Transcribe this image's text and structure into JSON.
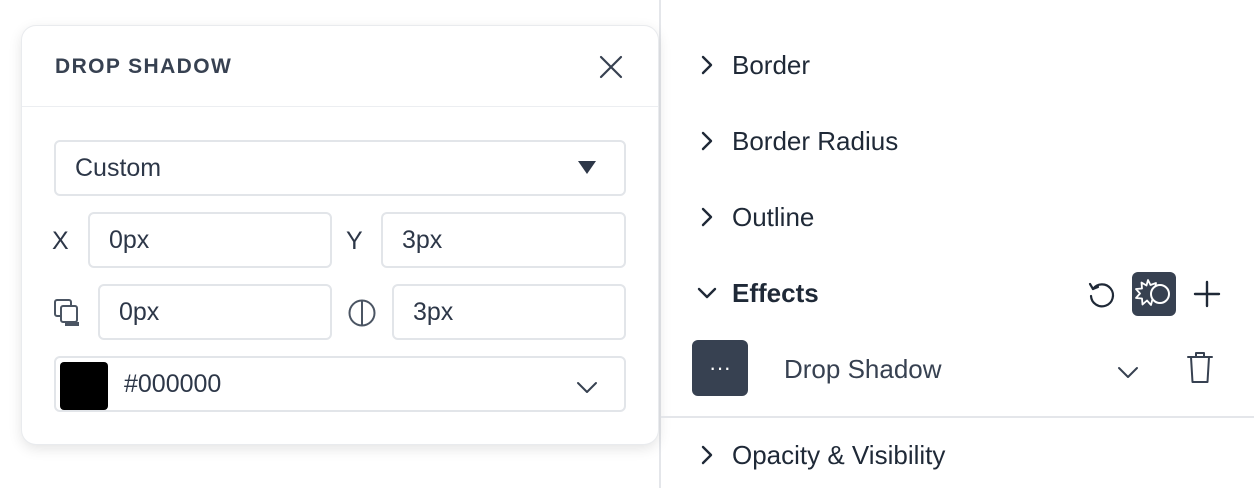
{
  "popover": {
    "title": "DROP SHADOW",
    "preset": "Custom",
    "x_label": "X",
    "x_value": "0px",
    "y_label": "Y",
    "y_value": "3px",
    "spread_value": "0px",
    "blur_value": "3px",
    "color_value": "#000000",
    "swatch_color": "#000000"
  },
  "panel": {
    "sections": {
      "border": "Border",
      "border_radius": "Border Radius",
      "outline": "Outline",
      "effects": "Effects",
      "opacity": "Opacity & Visibility"
    },
    "effect_item": {
      "more_label": "···",
      "name": "Drop Shadow"
    }
  },
  "colors": {
    "accent_dark": "#374151",
    "border": "#e2e5e9",
    "text": "#1f2937"
  },
  "icons": [
    "close-icon",
    "caret-down-icon",
    "chevron-down-icon",
    "shadow-spread-icon",
    "blur-icon",
    "chevron-right-icon",
    "reset-icon",
    "gear-icon",
    "plus-icon",
    "trash-icon"
  ]
}
